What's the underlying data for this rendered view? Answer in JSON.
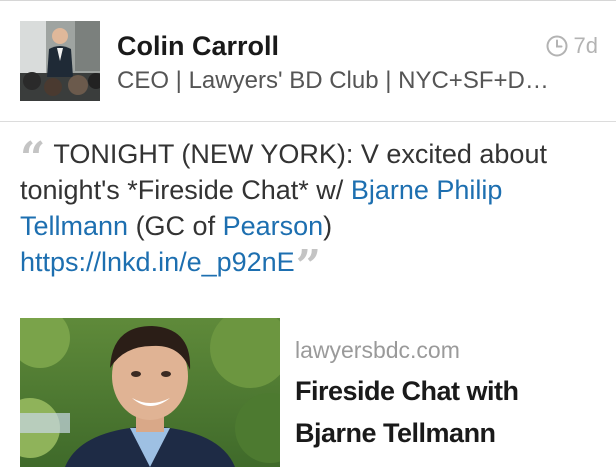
{
  "post": {
    "author": {
      "name": "Colin Carroll",
      "headline": "CEO | Lawyers' BD Club | NYC+SF+D…"
    },
    "timestamp": "7d",
    "text": {
      "intro": "TONIGHT (NEW YORK): V excited about tonight's *Fireside Chat* w/ ",
      "mention": "Bjarne Philip Tellmann",
      "middle": " (GC of ",
      "company": "Pearson",
      "after_company": ") ",
      "url": "https://lnkd.in/e_p92nE"
    },
    "icons": {
      "timestamp": "clock-icon",
      "quote_open": "open-quote-icon",
      "quote_close": "close-quote-icon"
    },
    "link_preview": {
      "domain": "lawyersbdc.com",
      "title": "Fireside Chat with Bjarne Tellmann"
    }
  },
  "colors": {
    "link": "#1d6fb0",
    "text": "#333333",
    "muted": "#9a9a9a",
    "quote": "#c4c4c4"
  }
}
